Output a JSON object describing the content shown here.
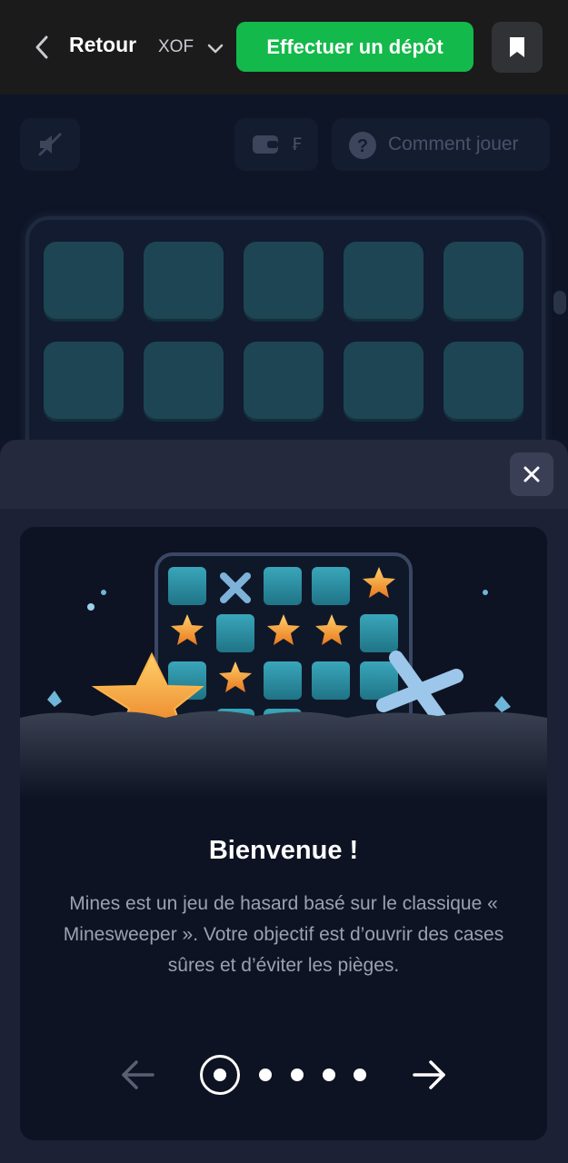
{
  "topbar": {
    "back_label": "Retour",
    "currency": "XOF",
    "deposit_label": "Effectuer un dépôt"
  },
  "game": {
    "help_label": "Comment jouer",
    "wallet_symbol": "₣"
  },
  "modal": {
    "title": "Bienvenue !",
    "body": "Mines est un jeu de hasard basé sur le classique « Minesweeper ». Votre objectif est d’ouvrir des cases sûres et d’éviter les pièges.",
    "pager": {
      "total": 5,
      "current": 1
    }
  },
  "colors": {
    "deposit_green": "#13b94a",
    "topbar_bg": "#1b1b1c",
    "sheet_bg": "#1c2136",
    "card_bg": "#0d1322",
    "tile_teal": "#2a8fa4",
    "star_orange": "#f0902a"
  },
  "icons": [
    "chevron-left-icon",
    "chevron-down-icon",
    "bookmark-icon",
    "sound-off-icon",
    "wallet-icon",
    "help-icon",
    "close-icon",
    "arrow-left-icon",
    "arrow-right-icon",
    "star-icon",
    "x-mark-icon"
  ]
}
